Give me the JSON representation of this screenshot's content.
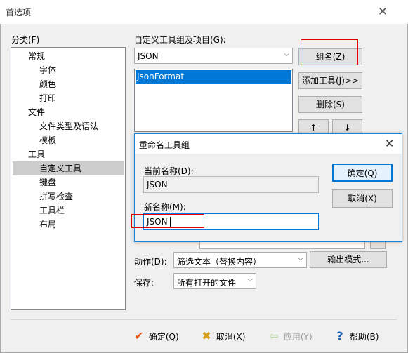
{
  "window": {
    "title": "首选项"
  },
  "category": {
    "label": "分类(F)",
    "items": [
      {
        "label": "常规",
        "level": 0,
        "selected": false
      },
      {
        "label": "字体",
        "level": 1,
        "selected": false
      },
      {
        "label": "颜色",
        "level": 1,
        "selected": false
      },
      {
        "label": "打印",
        "level": 1,
        "selected": false
      },
      {
        "label": "文件",
        "level": 0,
        "selected": false
      },
      {
        "label": "文件类型及语法",
        "level": 1,
        "selected": false
      },
      {
        "label": "模板",
        "level": 1,
        "selected": false
      },
      {
        "label": "工具",
        "level": 0,
        "selected": false
      },
      {
        "label": "自定义工具",
        "level": 1,
        "selected": true
      },
      {
        "label": "键盘",
        "level": 1,
        "selected": false
      },
      {
        "label": "拼写检查",
        "level": 1,
        "selected": false
      },
      {
        "label": "工具栏",
        "level": 1,
        "selected": false
      },
      {
        "label": "布局",
        "level": 1,
        "selected": false
      }
    ]
  },
  "tools": {
    "group_label": "自定义工具组及项目(G):",
    "group_value": "JSON",
    "list_items": [
      "JsonFormat"
    ],
    "group_button": "组名(Z)",
    "add_button": "添加工具(J)>>",
    "delete_button": "删除(S)",
    "up_arrow": "↑",
    "down_arrow": "↓",
    "action_label": "动作(D):",
    "action_value": "筛选文本（替换内容）",
    "output_mode_button": "输出模式...",
    "save_label": "保存:",
    "save_value": "所有打开的文件"
  },
  "rename_dialog": {
    "title": "重命名工具组",
    "current_label": "当前名称(D):",
    "current_value": "JSON",
    "new_label": "新名称(M):",
    "new_value": "JSON",
    "ok_button": "确定(Q)",
    "cancel_button": "取消(X)"
  },
  "bottom": {
    "ok": "确定(Q)",
    "cancel": "取消(X)",
    "apply": "应用(Y)",
    "help": "帮助(B)"
  },
  "colors": {
    "accent": "#0078d7",
    "highlight_box": "#e00000",
    "ok_icon": "#e05a1a",
    "cancel_icon": "#d4a017",
    "help_icon": "#1a5fb4"
  }
}
